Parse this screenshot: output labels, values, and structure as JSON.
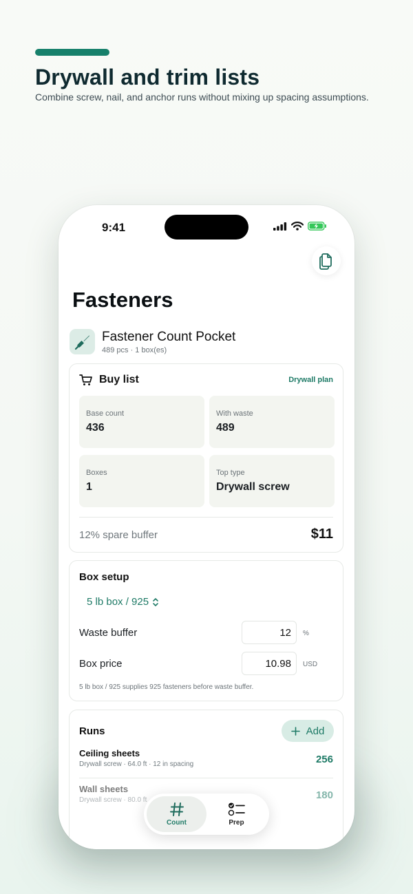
{
  "hero": {
    "title": "Drywall and trim lists",
    "subtitle": "Combine screw, nail, and anchor runs without mixing up spacing assumptions."
  },
  "status_bar": {
    "time": "9:41"
  },
  "page": {
    "title": "Fasteners"
  },
  "app": {
    "name": "Fastener Count Pocket",
    "meta": "489 pcs · 1 box(es)"
  },
  "buy_list": {
    "title": "Buy list",
    "plan_link": "Drywall plan",
    "stats": [
      {
        "label": "Base count",
        "value": "436"
      },
      {
        "label": "With waste",
        "value": "489"
      },
      {
        "label": "Boxes",
        "value": "1"
      },
      {
        "label": "Top type",
        "value": "Drywall screw"
      }
    ],
    "buffer_text": "12% spare buffer",
    "price": "$11"
  },
  "box_setup": {
    "title": "Box setup",
    "selected_box": "5 lb box / 925",
    "waste_label": "Waste buffer",
    "waste_value": "12",
    "waste_unit": "%",
    "price_label": "Box price",
    "price_value": "10.98",
    "price_unit": "USD",
    "help": "5 lb box / 925 supplies 925 fasteners before waste buffer."
  },
  "runs": {
    "title": "Runs",
    "add_label": "Add",
    "items": [
      {
        "name": "Ceiling sheets",
        "detail": "Drywall screw · 64.0 ft · 12 in spacing",
        "count": "256"
      },
      {
        "name": "Wall sheets",
        "detail": "Drywall screw · 80.0 ft · 16 in spacing",
        "count": "180"
      }
    ]
  },
  "tabbar": {
    "tabs": [
      {
        "label": "Count",
        "icon": "hash-icon",
        "active": true
      },
      {
        "label": "Prep",
        "icon": "checklist-icon",
        "active": false
      }
    ]
  },
  "colors": {
    "accent": "#17806b",
    "accent_text": "#1e7a66",
    "accent_bg": "#d8ece5"
  }
}
